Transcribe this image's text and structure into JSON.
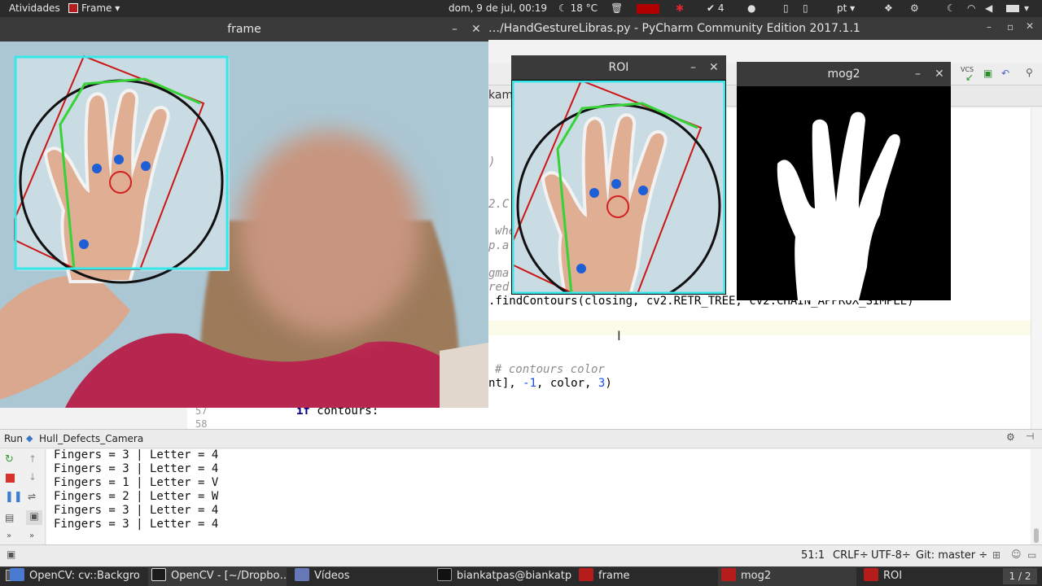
{
  "topbar": {
    "activities": "Atividades",
    "app_menu": "Frame",
    "clock": "dom,  9 de jul, 00:19",
    "weather": "18 °C",
    "badge_count": "4",
    "language": "pt"
  },
  "pycharm": {
    "title": "…/HandGestureLibras.py - PyCharm Community Edition 2017.1.1",
    "partial_tab": "kamp",
    "code": {
      "frag_a": ")",
      "frag_b": "2.C",
      "frag_c": "whe",
      "frag_d": "p.a",
      "frag_e": "gma",
      "frag_f": "red",
      "find_contours": ".findContours(closing, cv2.RETR_TREE, cv2.CHAIN_APPROX_SIMPLE)",
      "contours_color_comment": "# contours color",
      "draw_tail_1": "nt], ",
      "draw_tail_2": "-1",
      "draw_tail_3": ", color, ",
      "draw_tail_4": "3",
      "draw_tail_5": ")",
      "line_57": "57",
      "line_58": "58",
      "if_kw": "if",
      "if_rest": " contours:"
    },
    "run_panel": {
      "label": "Run",
      "config": "Hull_Defects_Camera",
      "output": [
        "Fingers = 3 | Letter = 4",
        "Fingers = 3 | Letter = 4",
        "Fingers = 1 | Letter = V",
        "Fingers = 2 | Letter = W",
        "Fingers = 3 | Letter = 4",
        "Fingers = 3 | Letter = 4"
      ]
    },
    "status": {
      "position": "51:1",
      "line_sep": "CRLF÷",
      "encoding": "UTF-8÷",
      "git": "Git: master ÷"
    }
  },
  "frame_window": {
    "title": "frame"
  },
  "roi_window": {
    "title": "ROI"
  },
  "mog2_window": {
    "title": "mog2"
  },
  "taskbar": {
    "items": [
      "OpenCV: cv::Backgro…",
      "OpenCV - [~/Dropbo…",
      "Vídeos",
      "biankatpas@biankatp…",
      "frame",
      "mog2",
      "ROI"
    ],
    "pager": "1 / 2"
  },
  "colors": {
    "roi_border": "#35e8ea",
    "hull": "#36d336",
    "bounding_rect": "#cc1515",
    "circle": "#111111",
    "defects": "#1f5fd6"
  }
}
